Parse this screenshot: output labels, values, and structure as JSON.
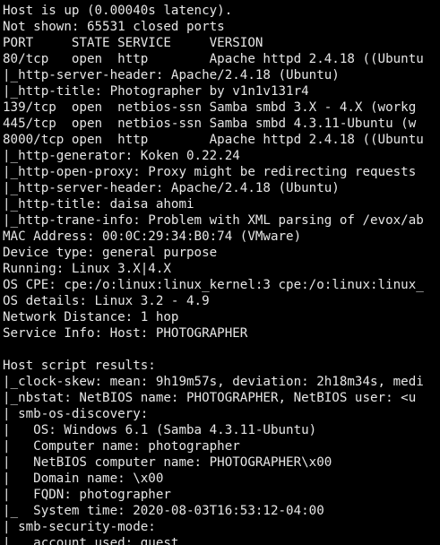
{
  "terminal": {
    "lines": [
      "Host is up (0.00040s latency).",
      "Not shown: 65531 closed ports",
      "PORT     STATE SERVICE     VERSION",
      "80/tcp   open  http        Apache httpd 2.4.18 ((Ubuntu",
      "|_http-server-header: Apache/2.4.18 (Ubuntu)",
      "|_http-title: Photographer by v1n1v131r4",
      "139/tcp  open  netbios-ssn Samba smbd 3.X - 4.X (workg",
      "445/tcp  open  netbios-ssn Samba smbd 4.3.11-Ubuntu (w",
      "8000/tcp open  http        Apache httpd 2.4.18 ((Ubuntu",
      "|_http-generator: Koken 0.22.24",
      "|_http-open-proxy: Proxy might be redirecting requests",
      "|_http-server-header: Apache/2.4.18 (Ubuntu)",
      "|_http-title: daisa ahomi",
      "|_http-trane-info: Problem with XML parsing of /evox/ab",
      "MAC Address: 00:0C:29:34:B0:74 (VMware)",
      "Device type: general purpose",
      "Running: Linux 3.X|4.X",
      "OS CPE: cpe:/o:linux:linux_kernel:3 cpe:/o:linux:linux_",
      "OS details: Linux 3.2 - 4.9",
      "Network Distance: 1 hop",
      "Service Info: Host: PHOTOGRAPHER",
      "",
      "Host script results:",
      "|_clock-skew: mean: 9h19m57s, deviation: 2h18m34s, medi",
      "|_nbstat: NetBIOS name: PHOTOGRAPHER, NetBIOS user: <u",
      "| smb-os-discovery:",
      "|   OS: Windows 6.1 (Samba 4.3.11-Ubuntu)",
      "|   Computer name: photographer",
      "|   NetBIOS computer name: PHOTOGRAPHER\\x00",
      "|   Domain name: \\x00",
      "|   FQDN: photographer",
      "|_  System time: 2020-08-03T16:53:12-04:00",
      "| smb-security-mode:",
      "|   account_used: guest"
    ]
  }
}
